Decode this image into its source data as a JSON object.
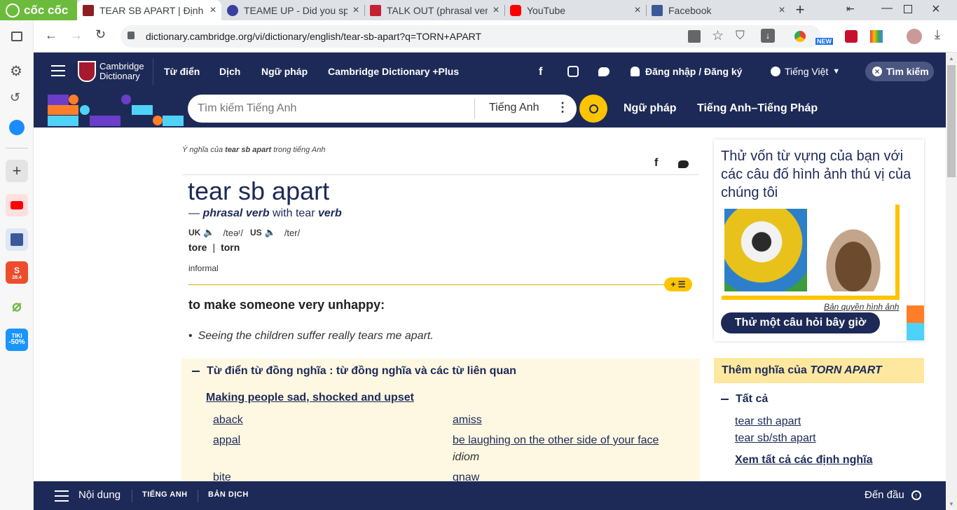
{
  "browser": {
    "logo": "cốc cốc",
    "tabs": [
      {
        "title": "TEAR SB APART | Định ng",
        "active": true
      },
      {
        "title": "TEAME UP - Did you sp",
        "active": false
      },
      {
        "title": "TALK OUT (phrasal verb",
        "active": false
      },
      {
        "title": "YouTube",
        "active": false
      },
      {
        "title": "Facebook",
        "active": false
      }
    ],
    "url": "dictionary.cambridge.org/vi/dictionary/english/tear-sb-apart?q=TORN+APART",
    "new_badge": "NEW"
  },
  "sidebar": {
    "shopee_badge": "28.4",
    "tiki_badge": "TIKI",
    "tiki_discount": "-50%"
  },
  "cambridge": {
    "logo_line1": "Cambridge",
    "logo_line2": "Dictionary",
    "nav": [
      "Từ điển",
      "Dịch",
      "Ngữ pháp",
      "Cambridge Dictionary +Plus"
    ],
    "login": "Đăng nhập / Đăng ký",
    "language": "Tiếng Việt",
    "search_button": "Tìm kiếm",
    "search_placeholder": "Tìm kiếm Tiếng Anh",
    "search_lang": "Tiếng Anh",
    "links": [
      "Ngữ pháp",
      "Tiếng Anh–Tiếng Pháp"
    ]
  },
  "entry": {
    "breadcrumb_pre": "Ý nghĩa của ",
    "breadcrumb_word": "tear sb apart",
    "breadcrumb_post": " trong tiếng Anh",
    "headword": "tear sb apart",
    "pos_dash": "— ",
    "pos": "phrasal verb",
    "pos_with": " with tear ",
    "pos_verb": "verb",
    "uk_label": "UK",
    "uk_ipa": "/teəʳ/",
    "us_label": "US",
    "us_ipa": "/ter/",
    "forms": [
      "tore",
      "torn"
    ],
    "register": "informal",
    "definition": "to make someone very unhappy:",
    "example": "Seeing the children suffer really tears me apart."
  },
  "thesaurus": {
    "heading": "Từ điển từ đồng nghĩa : từ đồng nghĩa và các từ liên quan",
    "group_title": "Making people sad, shocked and upset",
    "left_words": [
      "aback",
      "appal",
      "bite"
    ],
    "right_words": [
      "amiss",
      "be laughing on the other side of your face",
      "gnaw"
    ],
    "idiom_label": "idiom"
  },
  "quiz": {
    "text": "Thử vốn từ vựng của bạn với các câu đố hình ảnh thú vị của chúng tôi",
    "copyright": "Bản quyền hình ảnh",
    "button": "Thử một câu hỏi bây giờ"
  },
  "more_meanings": {
    "prefix": "Thêm nghĩa của ",
    "phrase": "TORN APART",
    "all_label": "Tất cả",
    "links": [
      "tear sth apart",
      "tear sb/sth apart"
    ],
    "see_all": "Xem tất cả các định nghĩa"
  },
  "bottom_bar": {
    "contents": "Nội dung",
    "english": "TIẾNG ANH",
    "translation": "BẢN DỊCH",
    "to_top": "Đến đầu"
  },
  "colors": {
    "cambridge_navy": "#1d2a57",
    "accent_yellow": "#fec400",
    "thesaurus_bg": "#fef7e2",
    "more_header_bg": "#fee8a0"
  }
}
